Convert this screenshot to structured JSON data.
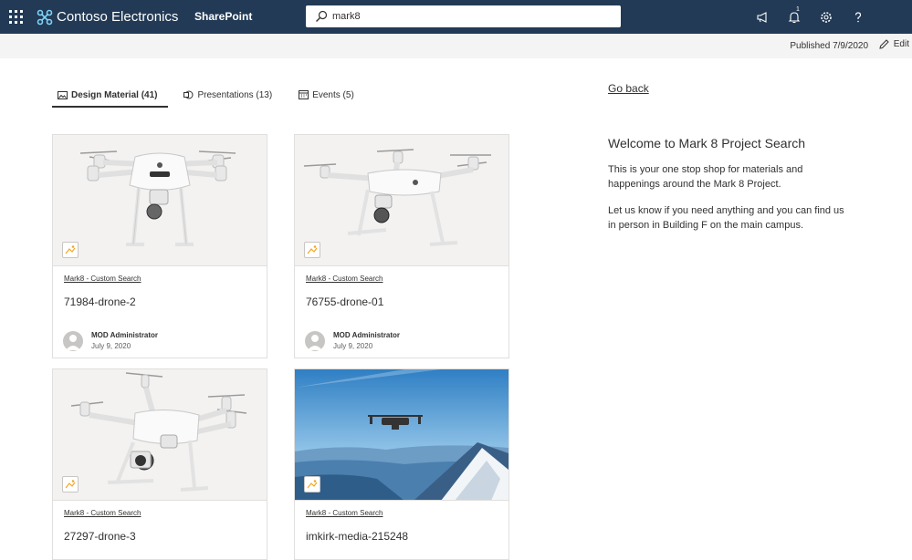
{
  "suitebar": {
    "brand": "Contoso Electronics",
    "app": "SharePoint",
    "search_value": "mark8",
    "notification_count": "1"
  },
  "commandbar": {
    "published": "Published 7/9/2020",
    "edit": "Edit"
  },
  "tabs": [
    {
      "label": "Design Material (41)",
      "icon": "image-icon",
      "active": true
    },
    {
      "label": "Presentations (13)",
      "icon": "powerpoint-icon",
      "active": false
    },
    {
      "label": "Events (5)",
      "icon": "calendar-icon",
      "active": false
    }
  ],
  "cards": [
    {
      "source": "Mark8 - Custom Search",
      "title": "71984-drone-2",
      "author": "MOD Administrator",
      "date": "July 9, 2020"
    },
    {
      "source": "Mark8 - Custom Search",
      "title": "76755-drone-01",
      "author": "MOD Administrator",
      "date": "July 9, 2020"
    },
    {
      "source": "Mark8 - Custom Search",
      "title": "27297-drone-3"
    },
    {
      "source": "Mark8 - Custom Search",
      "title": "imkirk-media-215248"
    }
  ],
  "right": {
    "go_back": "Go back",
    "welcome": "Welcome to Mark 8 Project Search",
    "para1": "This is your one stop shop for materials and happenings around the Mark 8 Project.",
    "para2": "Let us know if you need anything and you can find us in person in Building F on the main campus."
  },
  "colors": {
    "suitebar_bg": "#223a55",
    "commandbar_bg": "#f4f4f4"
  }
}
